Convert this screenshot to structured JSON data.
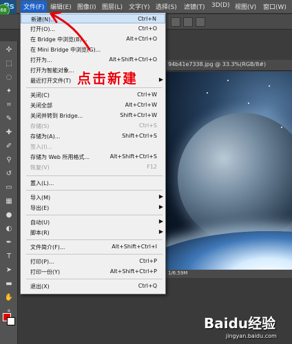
{
  "app": {
    "logo_text": "Ps",
    "badge": "68"
  },
  "menubar": {
    "items": [
      {
        "label": "文件(F)"
      },
      {
        "label": "编辑(E)"
      },
      {
        "label": "图像(I)"
      },
      {
        "label": "图层(L)"
      },
      {
        "label": "文字(Y)"
      },
      {
        "label": "选择(S)"
      },
      {
        "label": "滤镜(T)"
      },
      {
        "label": "3D(D)"
      },
      {
        "label": "视图(V)"
      },
      {
        "label": "窗口(W)"
      }
    ]
  },
  "document": {
    "tab_title": "94b41e7338.jpg @ 33.3%(RGB/8#)",
    "status_text": "1/6.59M"
  },
  "file_menu": {
    "items": [
      {
        "label": "新建(N)...",
        "shortcut": "Ctrl+N",
        "highlight": true
      },
      {
        "label": "打开(O)...",
        "shortcut": "Ctrl+O"
      },
      {
        "label": "在 Bridge 中浏览(B)...",
        "shortcut": "Alt+Ctrl+O"
      },
      {
        "label": "在 Mini Bridge 中浏览(G)...",
        "shortcut": ""
      },
      {
        "label": "打开为...",
        "shortcut": "Alt+Shift+Ctrl+O"
      },
      {
        "label": "打开为智能对象...",
        "shortcut": ""
      },
      {
        "label": "最近打开文件(T)",
        "shortcut": "",
        "submenu": true
      },
      {
        "label": "关闭(C)",
        "shortcut": "Ctrl+W"
      },
      {
        "label": "关闭全部",
        "shortcut": "Alt+Ctrl+W"
      },
      {
        "label": "关闭并转到 Bridge...",
        "shortcut": "Shift+Ctrl+W"
      },
      {
        "label": "存储(S)",
        "shortcut": "Ctrl+S",
        "disabled": true
      },
      {
        "label": "存储为(A)...",
        "shortcut": "Shift+Ctrl+S"
      },
      {
        "label": "签入(I)...",
        "shortcut": "",
        "disabled": true
      },
      {
        "label": "存储为 Web 所用格式...",
        "shortcut": "Alt+Shift+Ctrl+S"
      },
      {
        "label": "恢复(V)",
        "shortcut": "F12",
        "disabled": true
      },
      {
        "label": "置入(L)...",
        "shortcut": ""
      },
      {
        "label": "导入(M)",
        "shortcut": "",
        "submenu": true
      },
      {
        "label": "导出(E)",
        "shortcut": "",
        "submenu": true
      },
      {
        "label": "自动(U)",
        "shortcut": "",
        "submenu": true
      },
      {
        "label": "脚本(R)",
        "shortcut": "",
        "submenu": true
      },
      {
        "label": "文件简介(F)...",
        "shortcut": "Alt+Shift+Ctrl+I"
      },
      {
        "label": "打印(P)...",
        "shortcut": "Ctrl+P"
      },
      {
        "label": "打印一份(Y)",
        "shortcut": "Alt+Shift+Ctrl+P"
      },
      {
        "label": "退出(X)",
        "shortcut": "Ctrl+Q"
      }
    ]
  },
  "annotation": {
    "text": "点击新建",
    "color": "#e8000a"
  },
  "watermark": {
    "logo": "Baidu经验",
    "sub": "jingyan.baidu.com"
  },
  "colors": {
    "foreground": "#e60000",
    "background": "#ffffff",
    "menu_highlight": "#1f63c8"
  }
}
